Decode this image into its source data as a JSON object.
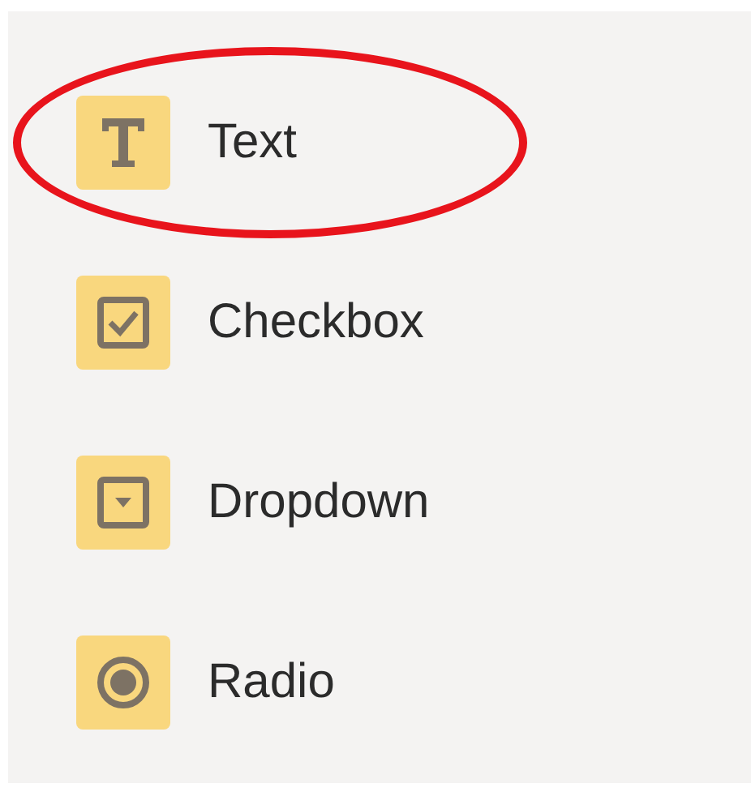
{
  "items": [
    {
      "kind": "text",
      "label": "Text",
      "highlighted": true
    },
    {
      "kind": "checkbox",
      "label": "Checkbox",
      "highlighted": false
    },
    {
      "kind": "dropdown",
      "label": "Dropdown",
      "highlighted": false
    },
    {
      "kind": "radio",
      "label": "Radio",
      "highlighted": false
    }
  ]
}
